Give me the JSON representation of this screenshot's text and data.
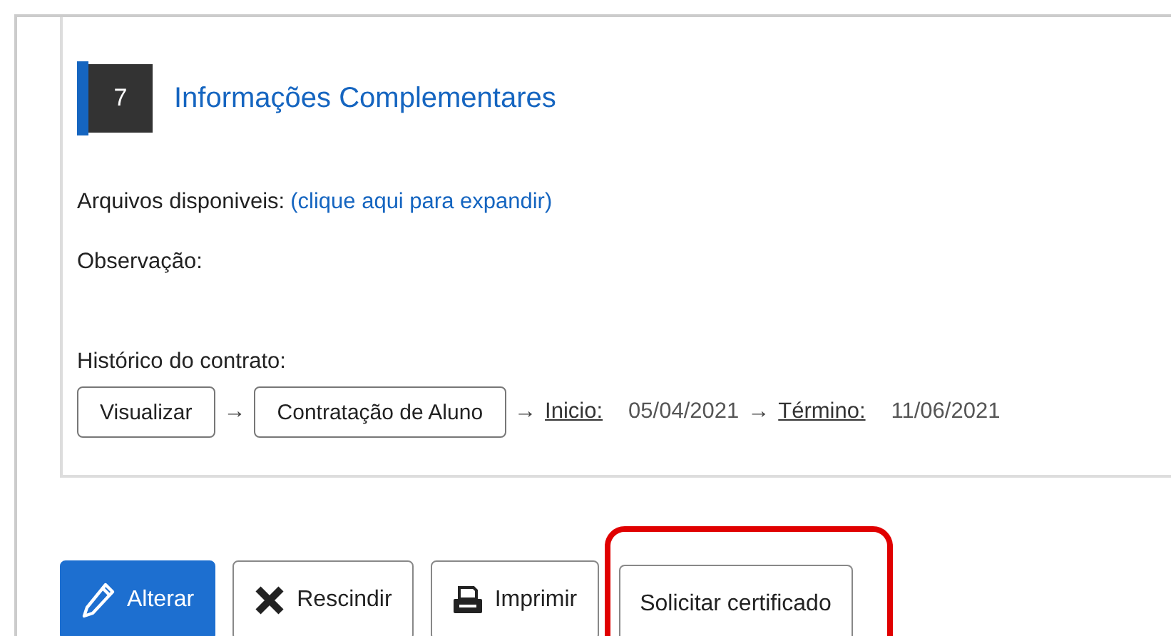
{
  "section": {
    "number": "7",
    "title": "Informações Complementares"
  },
  "files": {
    "label": "Arquivos disponiveis:",
    "link": "(clique aqui para expandir)"
  },
  "observation": {
    "label": "Observação:"
  },
  "history": {
    "label": "Histórico do contrato:",
    "view_button": "Visualizar",
    "arrow_1": "→",
    "step_button": "Contratação de Aluno",
    "arrow_2": "→",
    "start_label": "Inicio:",
    "start_date": "05/04/2021",
    "arrow_3": "→",
    "end_label": "Término:",
    "end_date": "11/06/2021"
  },
  "actions": [
    {
      "kind": "edit",
      "label": "Alterar",
      "highlighted": false
    },
    {
      "kind": "cancel",
      "label": "Rescindir",
      "highlighted": false
    },
    {
      "kind": "print",
      "label": "Imprimir",
      "highlighted": false
    },
    {
      "kind": "plain",
      "label": "Solicitar certificado",
      "highlighted": true
    }
  ]
}
